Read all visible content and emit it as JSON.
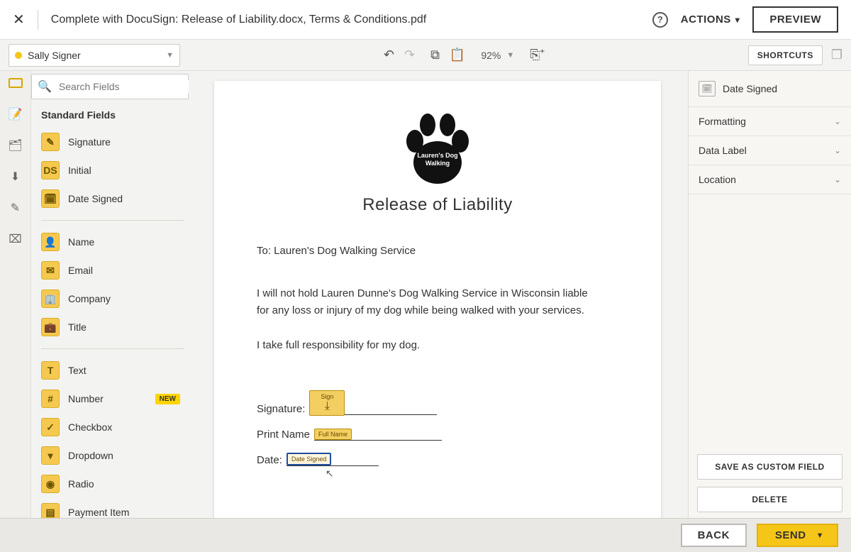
{
  "header": {
    "title": "Complete with DocuSign: Release of Liability.docx, Terms & Conditions.pdf",
    "actions_label": "ACTIONS",
    "preview_label": "PREVIEW"
  },
  "toolbar": {
    "recipient": "Sally Signer",
    "zoom": "92%",
    "shortcuts_label": "SHORTCUTS"
  },
  "left": {
    "search_placeholder": "Search Fields",
    "section_title": "Standard Fields",
    "fields_a": [
      {
        "icon": "✎",
        "label": "Signature"
      },
      {
        "icon": "DS",
        "label": "Initial"
      },
      {
        "icon": "🗓",
        "label": "Date Signed"
      }
    ],
    "fields_b": [
      {
        "icon": "👤",
        "label": "Name"
      },
      {
        "icon": "✉",
        "label": "Email"
      },
      {
        "icon": "🏢",
        "label": "Company"
      },
      {
        "icon": "💼",
        "label": "Title"
      }
    ],
    "fields_c": [
      {
        "icon": "T",
        "label": "Text",
        "badge": ""
      },
      {
        "icon": "#",
        "label": "Number",
        "badge": "NEW"
      },
      {
        "icon": "✓",
        "label": "Checkbox",
        "badge": ""
      },
      {
        "icon": "▾",
        "label": "Dropdown",
        "badge": ""
      },
      {
        "icon": "◉",
        "label": "Radio",
        "badge": ""
      },
      {
        "icon": "▤",
        "label": "Payment Item",
        "badge": ""
      }
    ]
  },
  "document": {
    "logo_text_lines": "Lauren's Dog Walking",
    "heading": "Release of Liability",
    "to_line": "To: Lauren's Dog Walking Service",
    "para1": "I will not hold Lauren Dunne's Dog Walking Service in Wisconsin liable for any loss or injury of my dog while being walked with your services.",
    "para2": "I take full responsibility for my dog.",
    "signature_label": "Signature:",
    "printname_label": "Print Name",
    "date_label": "Date:",
    "tag_sign": "Sign",
    "tag_fullname": "Full Name",
    "tag_datesigned": "Date Signed"
  },
  "right": {
    "field_name": "Date Signed",
    "sections": [
      "Formatting",
      "Data Label",
      "Location"
    ],
    "save_btn": "SAVE AS CUSTOM FIELD",
    "delete_btn": "DELETE"
  },
  "footer": {
    "back": "BACK",
    "send": "SEND"
  }
}
